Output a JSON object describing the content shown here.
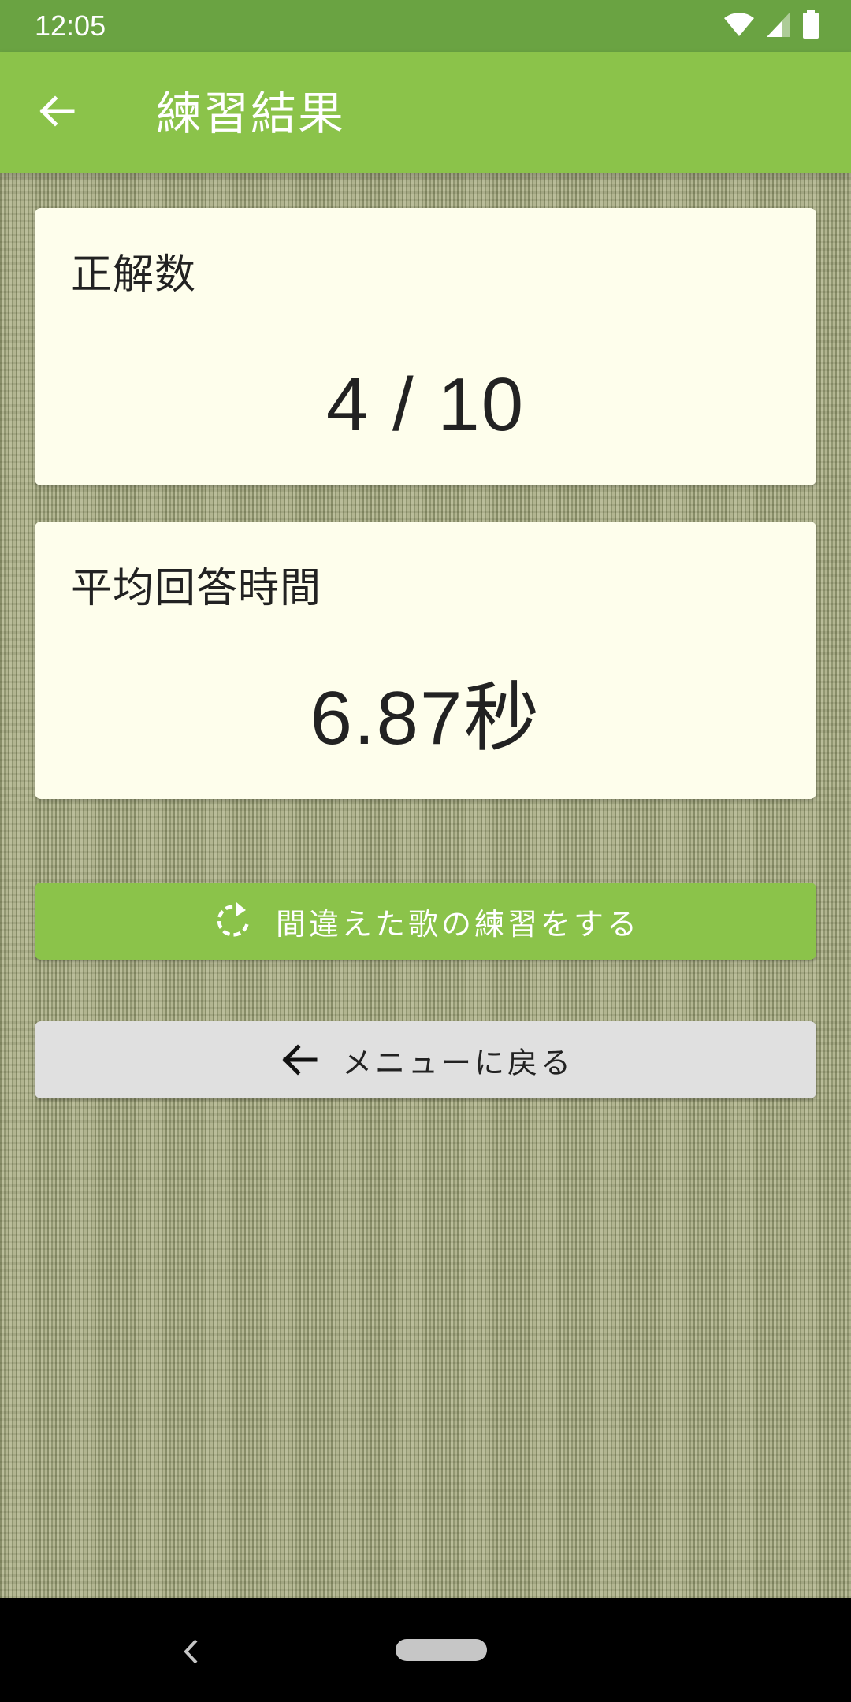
{
  "status_bar": {
    "time": "12:05",
    "icons": [
      "wifi-icon",
      "signal-icon",
      "battery-icon"
    ]
  },
  "app_bar": {
    "back_icon": "arrow-left-icon",
    "title": "練習結果"
  },
  "results": {
    "correct": {
      "label": "正解数",
      "value": "4 / 10"
    },
    "average_time": {
      "label": "平均回答時間",
      "value": "6.87秒"
    }
  },
  "actions": {
    "retry": {
      "icon": "refresh-icon",
      "label": "間違えた歌の練習をする"
    },
    "menu": {
      "icon": "arrow-left-icon",
      "label": "メニューに戻る"
    }
  },
  "colors": {
    "status_bar": "#6aa342",
    "app_bar": "#8bc34a",
    "card": "#fefeec",
    "retry_button": "#8bc34a",
    "menu_button": "#e0e0e0",
    "background": "#a7ab82"
  }
}
